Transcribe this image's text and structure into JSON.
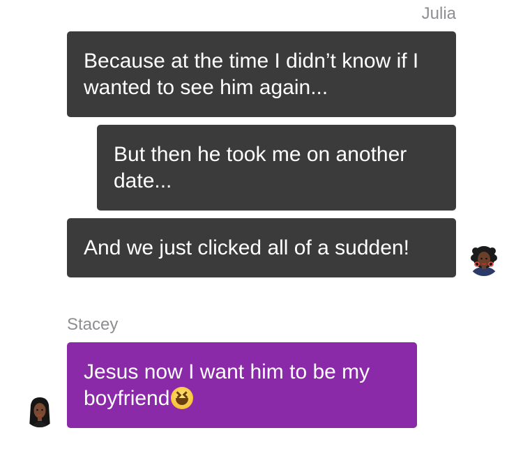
{
  "conversation": {
    "julia": {
      "name": "Julia",
      "messages": [
        "Because at the time I didn’t know if I wanted to see him again...",
        "But then he took me on another date...",
        "And we just clicked all of a sudden!"
      ],
      "bubble_color": "#3b3b3b",
      "avatar_icon": "julia-avatar-icon"
    },
    "stacey": {
      "name": "Stacey",
      "messages": [
        "Jesus now I want him to be my boyfriend"
      ],
      "emoji": "grinning-squinting-face-emoji",
      "bubble_color": "#8a2aa8",
      "avatar_icon": "stacey-avatar-icon"
    }
  }
}
